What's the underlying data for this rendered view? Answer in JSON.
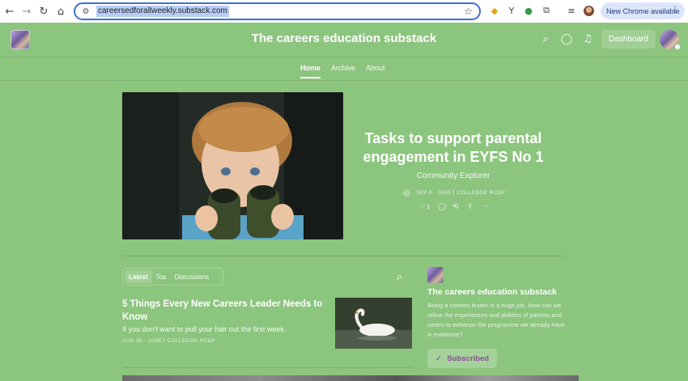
{
  "browser": {
    "url": "careersedforallweekly.substack.com",
    "update_label": "New Chrome available",
    "menu_glyph": "⋮",
    "icons": {
      "back": "←",
      "forward": "→",
      "reload": "↻",
      "home": "⌂",
      "site_info": "⚙",
      "bookmark": "☆",
      "ext1": "◆",
      "ext2": "Y",
      "ext3": "●",
      "ext4": "⧉",
      "ext5": "≡"
    },
    "colors": {
      "accent": "#3b6fd6",
      "url_highlight": "#b8cdf5"
    }
  },
  "header": {
    "title": "The careers education substack",
    "dashboard_label": "Dashboard",
    "icons": {
      "search": "⌕",
      "chat": "◯",
      "bell": "♫"
    }
  },
  "nav": {
    "tabs": [
      {
        "label": "Home",
        "active": true
      },
      {
        "label": "Archive",
        "active": false
      },
      {
        "label": "About",
        "active": false
      }
    ]
  },
  "featured": {
    "title": "Tasks to support parental engagement in EYFS No 1",
    "subtitle": "Community Explorer",
    "meta": "SEP 8 · JANET COLLEDGE RCDP",
    "likes": "1",
    "icons": {
      "heart": "♡",
      "comment": "◯",
      "restack": "⟲",
      "share": "⇪",
      "more": "···"
    }
  },
  "posts": {
    "filters": [
      {
        "label": "Latest",
        "active": true
      },
      {
        "label": "Top",
        "active": false
      },
      {
        "label": "Discussions",
        "active": false
      }
    ],
    "search_glyph": "⌕",
    "items": [
      {
        "title": "5 Things Every New Careers Leader Needs to Know",
        "subtitle": "If you don't want to pull your hair out the first week.",
        "meta": "AUG 30 · JANET COLLEDGE RCDP"
      }
    ]
  },
  "sidebar": {
    "title": "The careers education substack",
    "description": "Being a careers leader is a huge job. How can we utilise the experiences and abilities of parents and carers to enhance the programme we already have in existence?",
    "subscribed_label": "Subscribed",
    "check_glyph": "✓"
  },
  "theme": {
    "background": "#8cc57e",
    "subscribed_text": "#8c4d9c"
  }
}
